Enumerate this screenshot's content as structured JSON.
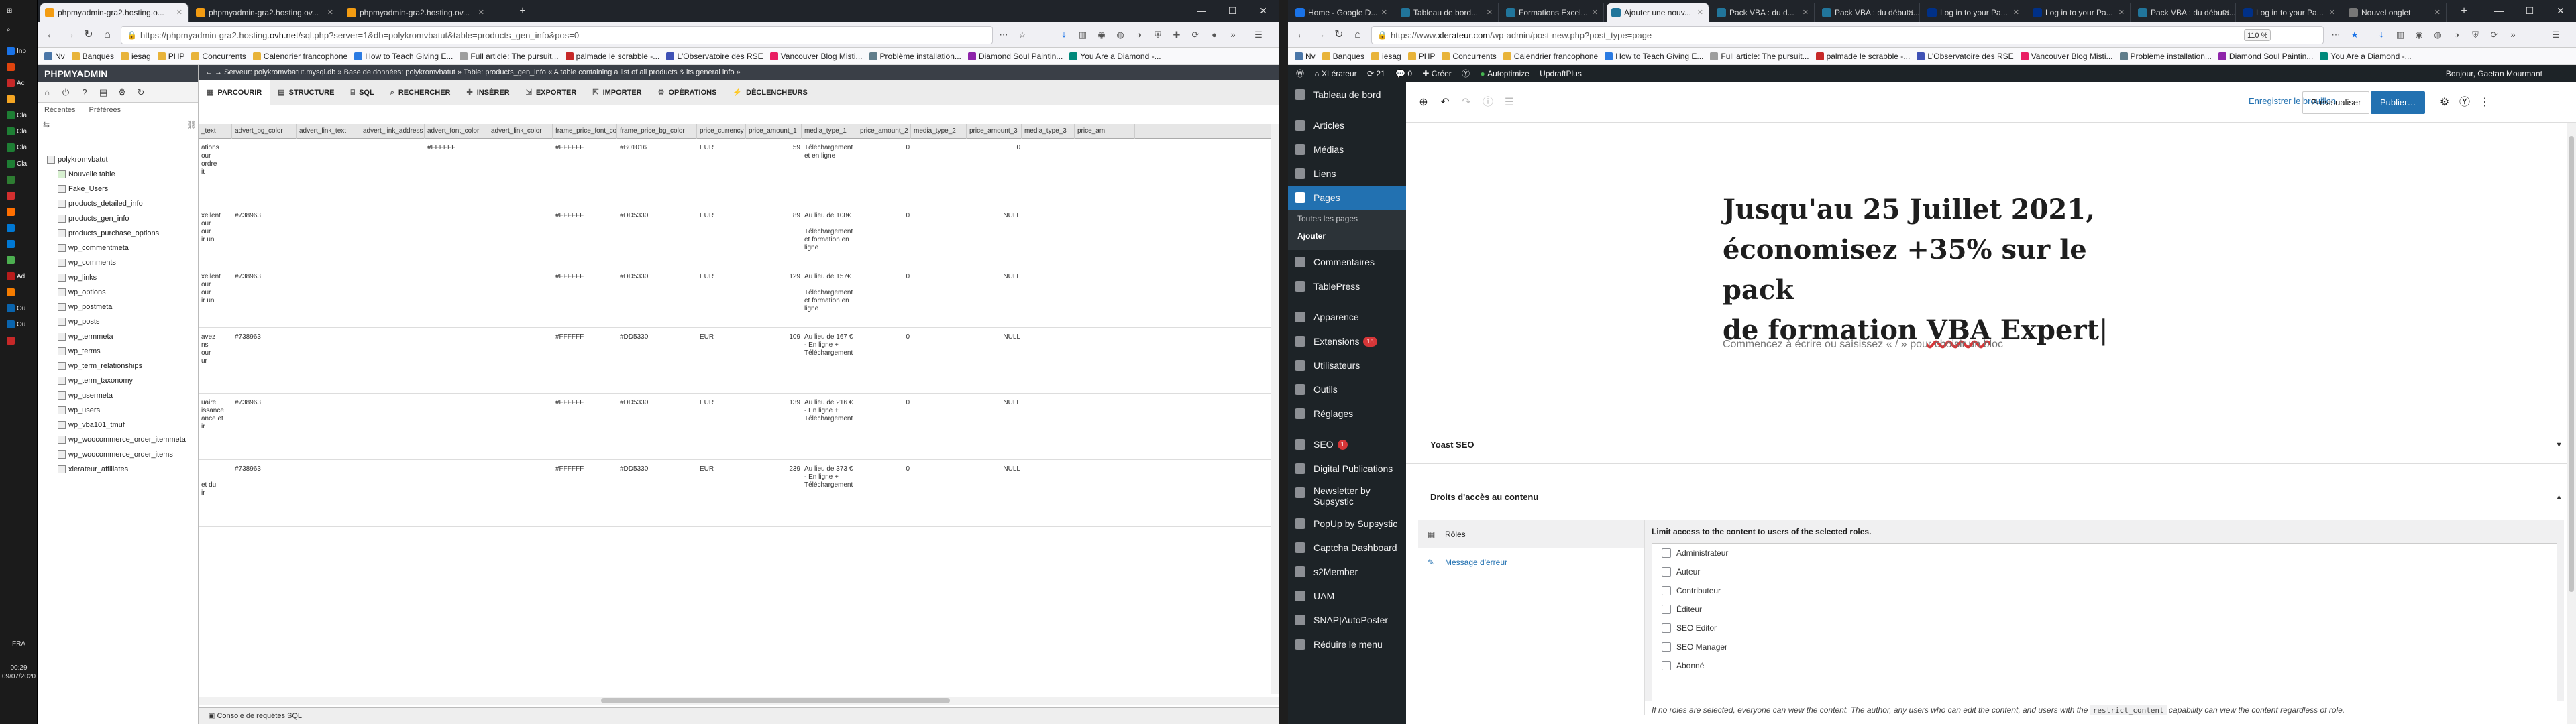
{
  "taskbar": {
    "apps": [
      {
        "label": "Inb",
        "color": "#1a73e8"
      },
      {
        "label": "",
        "color": "#e0440e"
      },
      {
        "label": "Ac",
        "color": "#c62828"
      },
      {
        "label": "",
        "color": "#f5a623"
      },
      {
        "label": "Cla",
        "color": "#1e7e34"
      },
      {
        "label": "Cla",
        "color": "#1e7e34"
      },
      {
        "label": "Cla",
        "color": "#1e7e34"
      },
      {
        "label": "Cla",
        "color": "#1e7e34"
      },
      {
        "label": "",
        "color": "#2e7d32"
      },
      {
        "label": "",
        "color": "#d32f2f"
      },
      {
        "label": "",
        "color": "#ff6f00"
      },
      {
        "label": "",
        "color": "#0078d4"
      },
      {
        "label": "",
        "color": "#0078d4"
      },
      {
        "label": "",
        "color": "#4caf50"
      },
      {
        "label": "Ad",
        "color": "#b71c1c"
      },
      {
        "label": "",
        "color": "#f57c00"
      },
      {
        "label": "Ou",
        "color": "#0a64ad"
      },
      {
        "label": "Ou",
        "color": "#0a64ad"
      },
      {
        "label": "",
        "color": "#c62828"
      }
    ],
    "lang": "FRA",
    "time": "00:29",
    "date": "09/07/2020"
  },
  "left_browser": {
    "tabs": [
      {
        "label": "phpmyadmin-gra2.hosting.o...",
        "color": "#f39c12",
        "active": true
      },
      {
        "label": "phpmyadmin-gra2.hosting.ov...",
        "color": "#f39c12",
        "active": false
      },
      {
        "label": "phpmyadmin-gra2.hosting.ov...",
        "color": "#f39c12",
        "active": false
      }
    ],
    "url_prefix": "https://phpmyadmin-gra2.hosting.",
    "url_domain": "ovh.net",
    "url_suffix": "/sql.php?server=1&db=polykromvbatut&table=products_gen_info&pos=0",
    "bookmarks": [
      {
        "label": "Nv",
        "color": "#4a76a8"
      },
      {
        "label": "Banques",
        "color": "#e8b339"
      },
      {
        "label": "iesag",
        "color": "#e8b339"
      },
      {
        "label": "PHP",
        "color": "#e8b339"
      },
      {
        "label": "Concurrents",
        "color": "#e8b339"
      },
      {
        "label": "Calendrier francophone",
        "color": "#e8b339"
      },
      {
        "label": "How to Teach Giving E...",
        "color": "#2a7ae2"
      },
      {
        "label": "Full article: The pursuit...",
        "color": "#9e9e9e"
      },
      {
        "label": "palmade le scrabble -...",
        "color": "#c62828"
      },
      {
        "label": "L'Observatoire des RSE",
        "color": "#3f51b5"
      },
      {
        "label": "Vancouver Blog Misti...",
        "color": "#e91e63"
      },
      {
        "label": "Problème installation...",
        "color": "#607d8b"
      },
      {
        "label": "Diamond Soul Paintin...",
        "color": "#8e24aa"
      },
      {
        "label": "You Are a Diamond -...",
        "color": "#00897b"
      }
    ]
  },
  "pma": {
    "logo": "PHPMYADMIN",
    "recent": "Récentes",
    "favorites": "Préférées",
    "tree": {
      "db": "polykromvbatut",
      "new_table": "Nouvelle table",
      "tables": [
        "Fake_Users",
        "products_detailed_info",
        "products_gen_info",
        "products_purchase_options",
        "wp_commentmeta",
        "wp_comments",
        "wp_links",
        "wp_options",
        "wp_postmeta",
        "wp_posts",
        "wp_termmeta",
        "wp_terms",
        "wp_term_relationships",
        "wp_term_taxonomy",
        "wp_usermeta",
        "wp_users",
        "wp_vba101_tmuf",
        "wp_woocommerce_order_itemmeta",
        "wp_woocommerce_order_items",
        "xlerateur_affiliates"
      ]
    },
    "breadcrumb": "← → Serveur: polykromvbatut.mysql.db  »  Base de données: polykromvbatut  »  Table: products_gen_info  « A table containing a list of all products & its general info »",
    "menu": [
      {
        "label": "PARCOURIR",
        "icon": "▦"
      },
      {
        "label": "STRUCTURE",
        "icon": "▤"
      },
      {
        "label": "SQL",
        "icon": "⌸"
      },
      {
        "label": "RECHERCHER",
        "icon": "⌕"
      },
      {
        "label": "INSÉRER",
        "icon": "✚"
      },
      {
        "label": "EXPORTER",
        "icon": "⇲"
      },
      {
        "label": "IMPORTER",
        "icon": "⇱"
      },
      {
        "label": "OPÉRATIONS",
        "icon": "⚙"
      },
      {
        "label": "DÉCLENCHEURS",
        "icon": "⚡"
      }
    ],
    "columns": [
      "_text",
      "advert_bg_color",
      "advert_link_text",
      "advert_link_address",
      "advert_font_color",
      "advert_link_color",
      "frame_price_font_color",
      "frame_price_bg_color",
      "price_currency",
      "price_amount_1",
      "media_type_1",
      "price_amount_2",
      "media_type_2",
      "price_amount_3",
      "media_type_3",
      "price_am"
    ],
    "rows": [
      {
        "c0": [
          "ations",
          "our",
          "ordre",
          "it"
        ],
        "c1": "",
        "c4": "#FFFFFF",
        "c6": "#FFFFFF",
        "c7": "#B01016",
        "c8": "EUR",
        "c9": "59",
        "c10": [
          "Téléchargement",
          "et en ligne"
        ],
        "c11": "0",
        "c13": "0"
      },
      {
        "c0": [
          "xellent",
          "our",
          "our",
          "ir un"
        ],
        "c1": "#738963",
        "c4": "",
        "c6": "#FFFFFF",
        "c7": "#DD5330",
        "c8": "EUR",
        "c9": "89",
        "c10": [
          "Au lieu de 108€",
          "",
          "Téléchargement",
          "et formation en",
          "ligne"
        ],
        "c11": "0",
        "c13": "NULL"
      },
      {
        "c0": [
          "xellent",
          "our",
          "our",
          "ir un"
        ],
        "c1": "#738963",
        "c4": "",
        "c6": "#FFFFFF",
        "c7": "#DD5330",
        "c8": "EUR",
        "c9": "129",
        "c10": [
          "Au lieu de 157€",
          "",
          "Téléchargement",
          "et formation en",
          "ligne"
        ],
        "c11": "0",
        "c13": "NULL"
      },
      {
        "c0": [
          "avez",
          "ns",
          "our",
          "ur"
        ],
        "c1": "#738963",
        "c4": "",
        "c6": "#FFFFFF",
        "c7": "#DD5330",
        "c8": "EUR",
        "c9": "109",
        "c10": [
          "Au lieu de 167 €",
          "- En ligne +",
          "Téléchargement"
        ],
        "c11": "0",
        "c13": "NULL"
      },
      {
        "c0": [
          "uaire",
          "issance",
          "ance et",
          "ir"
        ],
        "c1": "#738963",
        "c4": "",
        "c6": "#FFFFFF",
        "c7": "#DD5330",
        "c8": "EUR",
        "c9": "139",
        "c10": [
          "Au lieu de 216 €",
          "- En ligne +",
          "Téléchargement"
        ],
        "c11": "0",
        "c13": "NULL"
      },
      {
        "c0": [
          "",
          "",
          "et du",
          "ir"
        ],
        "c1": "#738963",
        "c4": "",
        "c6": "#FFFFFF",
        "c7": "#DD5330",
        "c8": "EUR",
        "c9": "239",
        "c10": [
          "Au lieu de 373 €",
          "- En ligne +",
          "Téléchargement"
        ],
        "c11": "0",
        "c13": "NULL"
      }
    ],
    "console": "Console de requêtes SQL"
  },
  "right_browser": {
    "tabs": [
      {
        "label": "Home - Google D...",
        "color": "#1a73e8",
        "active": false
      },
      {
        "label": "Tableau de bord...",
        "color": "#21759b",
        "active": false
      },
      {
        "label": "Formations Excel...",
        "color": "#21759b",
        "active": false
      },
      {
        "label": "Ajouter une nouv...",
        "color": "#21759b",
        "active": true
      },
      {
        "label": "Pack VBA : du d...",
        "color": "#21759b",
        "active": false
      },
      {
        "label": "Pack VBA : du débuta...",
        "color": "#21759b",
        "active": false
      },
      {
        "label": "Log in to your Pa...",
        "color": "#003087",
        "active": false
      },
      {
        "label": "Log in to your Pa...",
        "color": "#003087",
        "active": false
      },
      {
        "label": "Pack VBA : du débuta...",
        "color": "#21759b",
        "active": false
      },
      {
        "label": "Log in to your Pa...",
        "color": "#003087",
        "active": false
      },
      {
        "label": "Nouvel onglet",
        "color": "#777777",
        "active": false
      }
    ],
    "url_prefix": "https://www.",
    "url_domain": "xlerateur.com",
    "url_suffix": "/wp-admin/post-new.php?post_type=page",
    "zoom": "110 %",
    "bookmarks": [
      {
        "label": "Nv",
        "color": "#4a76a8"
      },
      {
        "label": "Banques",
        "color": "#e8b339"
      },
      {
        "label": "iesag",
        "color": "#e8b339"
      },
      {
        "label": "PHP",
        "color": "#e8b339"
      },
      {
        "label": "Concurrents",
        "color": "#e8b339"
      },
      {
        "label": "Calendrier francophone",
        "color": "#e8b339"
      },
      {
        "label": "How to Teach Giving E...",
        "color": "#2a7ae2"
      },
      {
        "label": "Full article: The pursuit...",
        "color": "#9e9e9e"
      },
      {
        "label": "palmade le scrabble -...",
        "color": "#c62828"
      },
      {
        "label": "L'Observatoire des RSE",
        "color": "#3f51b5"
      },
      {
        "label": "Vancouver Blog Misti...",
        "color": "#e91e63"
      },
      {
        "label": "Problème installation...",
        "color": "#607d8b"
      },
      {
        "label": "Diamond Soul Paintin...",
        "color": "#8e24aa"
      },
      {
        "label": "You Are a Diamond -...",
        "color": "#00897b"
      }
    ]
  },
  "wp": {
    "adminbar": {
      "site": "XLérateur",
      "updates": "21",
      "comments": "0",
      "new": "Créer",
      "autoptimize": "Autoptimize",
      "updraft": "UpdraftPlus",
      "greeting": "Bonjour, Gaetan Mourmant"
    },
    "sidebar": [
      {
        "label": "Tableau de bord",
        "active": false,
        "badge": ""
      },
      {
        "label": "",
        "sep": true
      },
      {
        "label": "Articles",
        "active": false,
        "badge": ""
      },
      {
        "label": "Médias",
        "active": false,
        "badge": ""
      },
      {
        "label": "Liens",
        "active": false,
        "badge": ""
      },
      {
        "label": "Pages",
        "active": true,
        "badge": ""
      }
    ],
    "pages_sub": [
      "Toutes les pages",
      "Ajouter"
    ],
    "sidebar2": [
      {
        "label": "Commentaires",
        "badge": ""
      },
      {
        "label": "TablePress",
        "badge": ""
      },
      {
        "label": "",
        "sep": true
      },
      {
        "label": "Apparence",
        "badge": ""
      },
      {
        "label": "Extensions",
        "badge": "18"
      },
      {
        "label": "Utilisateurs",
        "badge": ""
      },
      {
        "label": "Outils",
        "badge": ""
      },
      {
        "label": "Réglages",
        "badge": ""
      },
      {
        "label": "",
        "sep": true
      },
      {
        "label": "SEO",
        "badge": "1"
      },
      {
        "label": "Digital Publications",
        "badge": ""
      },
      {
        "label": "Newsletter by",
        "badge": "",
        "line2": "Supsystic"
      },
      {
        "label": "PopUp by Supsystic",
        "badge": ""
      },
      {
        "label": "Captcha Dashboard",
        "badge": ""
      },
      {
        "label": "s2Member",
        "badge": ""
      },
      {
        "label": "UAM",
        "badge": ""
      },
      {
        "label": "SNAP|AutoPoster",
        "badge": ""
      },
      {
        "label": "Réduire le menu",
        "badge": ""
      }
    ],
    "editor": {
      "save_draft": "Enregistrer le brouillon",
      "preview": "Prévisualiser",
      "publish": "Publier…",
      "title_1": "Jusqu'au 25 Juillet 2021,",
      "title_2": "économisez +35% sur le pack",
      "title_3a": "de formation ",
      "title_3b": "VBA",
      "title_3c": " Expert",
      "placeholder": "Commencez à écrire ou saisissez « / » pour choisir un bloc"
    },
    "yoast": "Yoast SEO",
    "access": {
      "title": "Droits d'accès au contenu",
      "left": [
        "Rôles",
        "Message d'erreur"
      ],
      "limit_title": "Limit access to the content to users of the selected roles.",
      "roles": [
        "Administrateur",
        "Auteur",
        "Contributeur",
        "Éditeur",
        "SEO Editor",
        "SEO Manager",
        "Abonné"
      ],
      "note_1": "If no roles are selected, everyone can view the content. The author, any users who can edit the content, and users with the ",
      "note_code": "restrict_content",
      "note_2": " capability can view the content regardless of role."
    }
  }
}
